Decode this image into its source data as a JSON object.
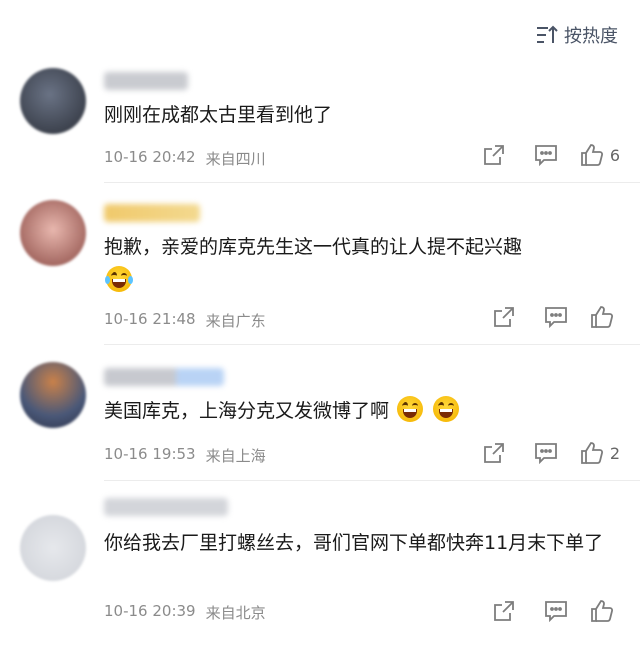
{
  "sort": {
    "label": "按热度",
    "icon": "sort-icon"
  },
  "comments": [
    {
      "text": "刚刚在成都太古里看到他了",
      "time": "10-16 20:42",
      "location": "来自四川",
      "likes": "6",
      "avatar_color": "#3a4150"
    },
    {
      "text": "抱歉，亲爱的库克先生这一代真的让人提不起兴趣",
      "time": "10-16 21:48",
      "location": "来自广东",
      "likes": "",
      "avatar_color": "#b76a5e",
      "emoji": "laugh-tears-emoji"
    },
    {
      "text": "美国库克，上海分克又发微博了啊",
      "time": "10-16 19:53",
      "location": "来自上海",
      "likes": "2",
      "avatar_color": "#4f5a7a",
      "emoji": "grin-emoji"
    },
    {
      "text": "你给我去厂里打螺丝去，哥们官网下单都快奔11月末下单了",
      "time": "10-16 20:39",
      "location": "来自北京",
      "likes": "",
      "avatar_color": "#cfd2d8"
    }
  ],
  "colors": {
    "meta_text": "#8b8b8b",
    "icon": "#7d7d7d",
    "divider": "#ececec",
    "sort_text": "#4a5466"
  }
}
